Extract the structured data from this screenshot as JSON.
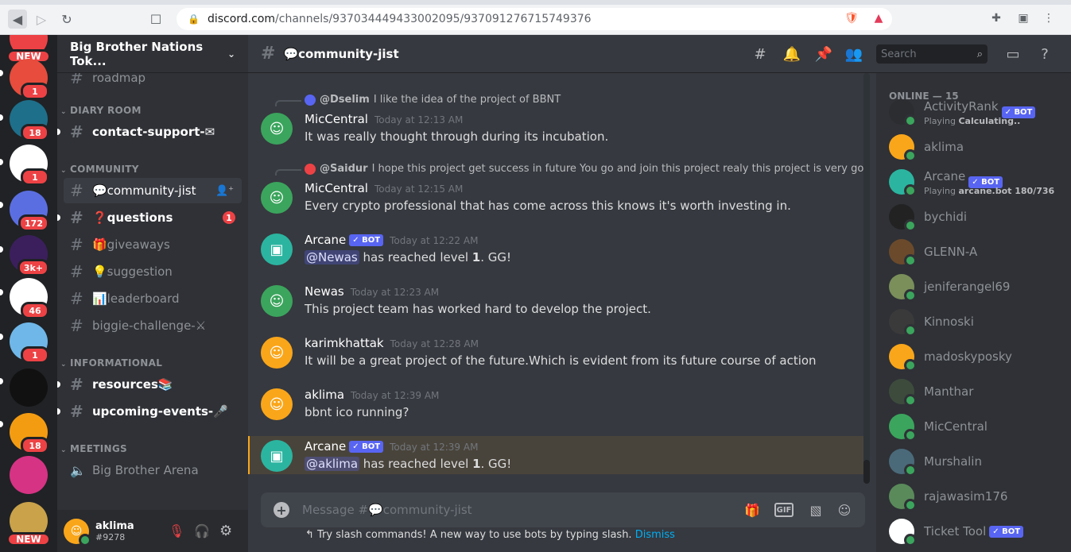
{
  "browser": {
    "url_host": "discord.com",
    "url_path": "/channels/937034449433002095/937091276715749376"
  },
  "server": {
    "name": "Big Brother Nations Tok..."
  },
  "guilds": [
    {
      "label": "NEW",
      "color": "#ed4245",
      "badge": ""
    },
    {
      "label": "",
      "color": "#e74c3c",
      "badge": "1"
    },
    {
      "label": "",
      "color": "#1e6f8a",
      "badge": "18"
    },
    {
      "label": "",
      "color": "#ffffff",
      "badge": "1"
    },
    {
      "label": "",
      "color": "#5b6ee1",
      "badge": "172"
    },
    {
      "label": "",
      "color": "#3b1f5c",
      "badge": "3k+"
    },
    {
      "label": "",
      "color": "#ffffff",
      "badge": "46"
    },
    {
      "label": "",
      "color": "#6fb7e8",
      "badge": "1"
    },
    {
      "label": "",
      "color": "#111111",
      "badge": ""
    },
    {
      "label": "",
      "color": "#f39c12",
      "badge": "18"
    },
    {
      "label": "",
      "color": "#d63384",
      "badge": ""
    },
    {
      "label": "NEW",
      "color": "#c9a24a",
      "badge": ""
    }
  ],
  "channels": {
    "roadmap": "roadmap",
    "cat_diary": "DIARY ROOM",
    "contact_support": "contact-support-✉",
    "cat_community": "COMMUNITY",
    "community_jist": "💬community-jist",
    "questions": "❓questions",
    "questions_badge": "1",
    "giveaways": "🎁giveaways",
    "suggestion": "💡suggestion",
    "leaderboard": "📊leaderboard",
    "biggie": "biggie-challenge-⚔",
    "cat_info": "INFORMATIONAL",
    "resources": "resources📚",
    "upcoming": "upcoming-events-🎤",
    "cat_meetings": "MEETINGS",
    "arena": "Big Brother Arena"
  },
  "user": {
    "name": "aklima",
    "tag": "#9278"
  },
  "header": {
    "channel": "💬community-jist",
    "search_placeholder": "Search"
  },
  "messages": [
    {
      "reply_name": "@Dselim",
      "reply_text": "I like the idea of the project of BBNT",
      "author": "MicCentral",
      "time": "Today at 12:13 AM",
      "text": "It was really thought through during its incubation.",
      "avatar_color": "#3ba55d"
    },
    {
      "reply_name": "@Saidur",
      "reply_text": "I hope this project get success in future You go and join this project realy this project is very good",
      "author": "MicCentral",
      "time": "Today at 12:15 AM",
      "text": "Every crypto professional that has come across this knows it's worth investing in.",
      "avatar_color": "#3ba55d"
    },
    {
      "author": "Arcane",
      "bot": "✓ BOT",
      "time": "Today at 12:22 AM",
      "mention": "@Newas",
      "text_pre": " has reached level ",
      "level": "1",
      "text_post": ". GG!",
      "avatar_color": "#2bb5a0"
    },
    {
      "author": "Newas",
      "time": "Today at 12:23 AM",
      "text": "This project team has worked hard to develop the project.",
      "avatar_color": "#3ba55d"
    },
    {
      "author": "karimkhattak",
      "time": "Today at 12:28 AM",
      "text": "It will be a great project of the future.Which is evident from its future course of action",
      "avatar_color": "#faa61a"
    },
    {
      "author": "aklima",
      "time": "Today at 12:39 AM",
      "text": "bbnt ico running?",
      "avatar_color": "#faa61a"
    },
    {
      "author": "Arcane",
      "bot": "✓ BOT",
      "time": "Today at 12:39 AM",
      "mention": "@aklima",
      "text_pre": " has reached level ",
      "level": "1",
      "text_post": ". GG!",
      "avatar_color": "#2bb5a0"
    }
  ],
  "composer": {
    "placeholder": "Message #💬community-jist",
    "hint": "Try slash commands! A new way to use bots by typing slash.",
    "dismiss": "Dismiss"
  },
  "members": {
    "online_header": "ONLINE — 15",
    "list": [
      {
        "name": "ActivityRank",
        "bot": "✓ BOT",
        "sub_pre": "Playing ",
        "sub_bold": "Calculating..",
        "color": "#2b2d31"
      },
      {
        "name": "aklima",
        "color": "#faa61a"
      },
      {
        "name": "Arcane",
        "bot": "✓ BOT",
        "sub_pre": "Playing ",
        "sub_bold": "arcane.bot 180/736",
        "color": "#2bb5a0"
      },
      {
        "name": "bychidi",
        "color": "#222222"
      },
      {
        "name": "GLENN-A",
        "color": "#6b4a2b"
      },
      {
        "name": "jeniferangel69",
        "color": "#7a8f5a"
      },
      {
        "name": "Kinnoski",
        "color": "#3a3a3a"
      },
      {
        "name": "madoskyposky",
        "color": "#faa61a"
      },
      {
        "name": "Manthar",
        "color": "#3d4b3d"
      },
      {
        "name": "MicCentral",
        "color": "#3ba55d"
      },
      {
        "name": "Murshalin",
        "color": "#4a6a7a"
      },
      {
        "name": "rajawasim176",
        "color": "#5a8a5a"
      },
      {
        "name": "Ticket Tool",
        "bot": "✓ BOT",
        "color": "#ffffff"
      }
    ]
  }
}
